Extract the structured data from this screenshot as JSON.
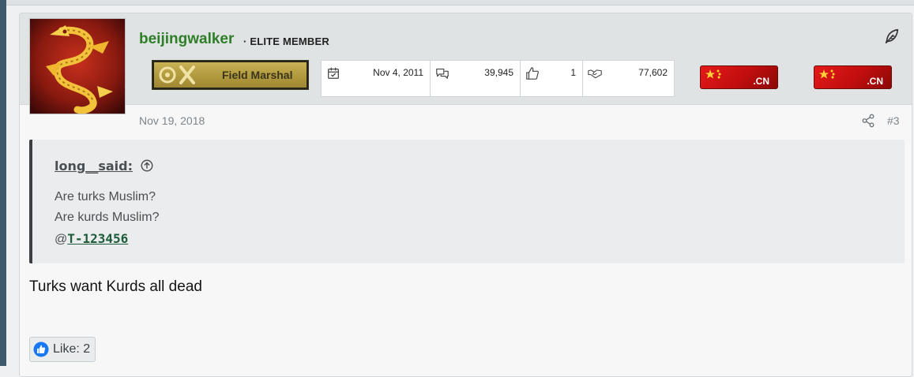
{
  "user": {
    "name": "beijingwalker",
    "title": "· ELITE MEMBER",
    "rank": "Field Marshal"
  },
  "stats": {
    "joined": "Nov 4, 2011",
    "messages": "39,945",
    "reactions": "1",
    "points": "77,602"
  },
  "flags": [
    {
      "label": ".CN"
    },
    {
      "label": ".CN"
    }
  ],
  "post": {
    "date": "Nov 19, 2018",
    "number": "#3",
    "quote": {
      "author": "long__said:",
      "lines": [
        "Are turks Muslim?",
        "Are kurds Muslim?"
      ],
      "mention_prefix": "@",
      "mention": "T-123456"
    },
    "body": "Turks want Kurds all dead",
    "like_label": "Like: 2"
  },
  "colors": {
    "username": "#2e7f27",
    "header_bg": "#dfe3e4",
    "flag_red": "#e51a1a",
    "like_blue": "#1877f2"
  },
  "icons": {
    "feather": "feather-icon",
    "calendar": "calendar-check-icon",
    "messages": "comments-icon",
    "reactions": "thumbs-up-icon",
    "points": "handshake-icon",
    "share": "share-icon",
    "quote_jump": "arrow-up-circle-icon",
    "like": "like-icon"
  }
}
